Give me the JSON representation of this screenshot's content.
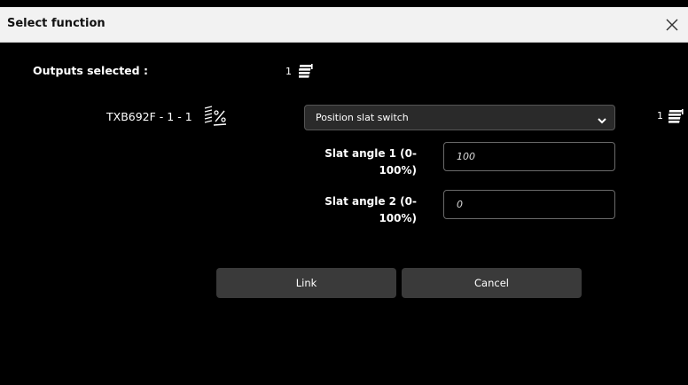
{
  "dialog": {
    "title": "Select function",
    "close_icon": "close-icon"
  },
  "outputs": {
    "label": "Outputs selected :",
    "count": "1",
    "icon": "blind-stack-icon"
  },
  "device": {
    "name": "TXB692F - 1 - 1",
    "icon": "blind-slat-percent-icon",
    "function_select": {
      "value": "Position slat switch"
    },
    "right_count": "1",
    "right_icon": "blind-stack-icon"
  },
  "fields": [
    {
      "label_line1": "Slat angle 1 (0-",
      "label_line2": "100%)",
      "value": "100"
    },
    {
      "label_line1": "Slat angle 2 (0-",
      "label_line2": "100%)",
      "value": "0"
    }
  ],
  "buttons": {
    "link": "Link",
    "cancel": "Cancel"
  },
  "colors": {
    "background": "#000000",
    "titlebar": "#f2f2f2",
    "button": "#3a3a3a",
    "select": "#2a2a2a"
  }
}
